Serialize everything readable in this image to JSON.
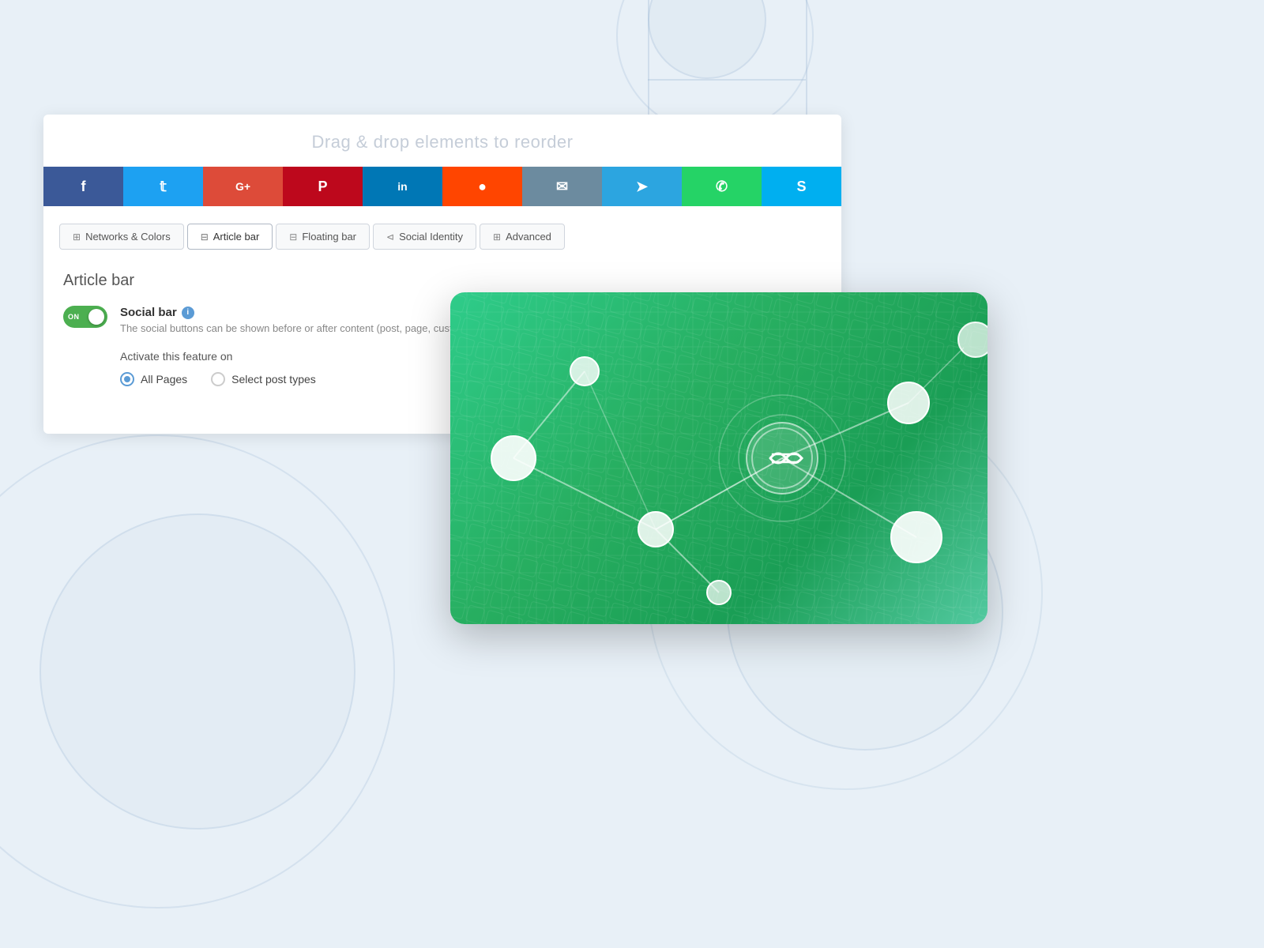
{
  "page": {
    "bg_hint": "light blue gradient background"
  },
  "drag_header": {
    "text": "Drag & drop elements to reorder"
  },
  "social_buttons": [
    {
      "id": "facebook",
      "icon": "f",
      "color": "#3b5998",
      "label": "Facebook"
    },
    {
      "id": "twitter",
      "icon": "𝕥",
      "color": "#1da1f2",
      "label": "Twitter"
    },
    {
      "id": "google",
      "icon": "G+",
      "color": "#dd4b39",
      "label": "Google+"
    },
    {
      "id": "pinterest",
      "icon": "𝕡",
      "color": "#bd081c",
      "label": "Pinterest"
    },
    {
      "id": "linkedin",
      "icon": "in",
      "color": "#0077b5",
      "label": "LinkedIn"
    },
    {
      "id": "reddit",
      "icon": "●",
      "color": "#ff4500",
      "label": "Reddit"
    },
    {
      "id": "email",
      "icon": "✉",
      "color": "#6c8b9f",
      "label": "Email"
    },
    {
      "id": "telegram",
      "icon": "➤",
      "color": "#2ca5e0",
      "label": "Telegram"
    },
    {
      "id": "whatsapp",
      "icon": "✆",
      "color": "#25d366",
      "label": "WhatsApp"
    },
    {
      "id": "skype",
      "icon": "𝕤",
      "color": "#00aff0",
      "label": "Skype"
    }
  ],
  "tabs": [
    {
      "id": "networks",
      "icon": "⊞",
      "label": "Networks & Colors",
      "active": false
    },
    {
      "id": "article",
      "icon": "⊟",
      "label": "Article bar",
      "active": true
    },
    {
      "id": "floating",
      "icon": "⊟",
      "label": "Floating bar",
      "active": false
    },
    {
      "id": "social-identity",
      "icon": "⊲",
      "label": "Social Identity",
      "active": false
    },
    {
      "id": "advanced",
      "icon": "⊞",
      "label": "Advanced",
      "active": false
    }
  ],
  "section": {
    "title": "Article bar"
  },
  "social_bar_feature": {
    "toggle_state": "ON",
    "toggle_on": true,
    "name": "Social bar",
    "description": "The social buttons can be shown before or after content (post, page, custo..."
  },
  "activate_feature": {
    "label": "Activate this feature on",
    "options": [
      {
        "id": "all-pages",
        "label": "All Pages",
        "selected": true
      },
      {
        "id": "select-post-types",
        "label": "Select post types",
        "selected": false
      }
    ]
  }
}
